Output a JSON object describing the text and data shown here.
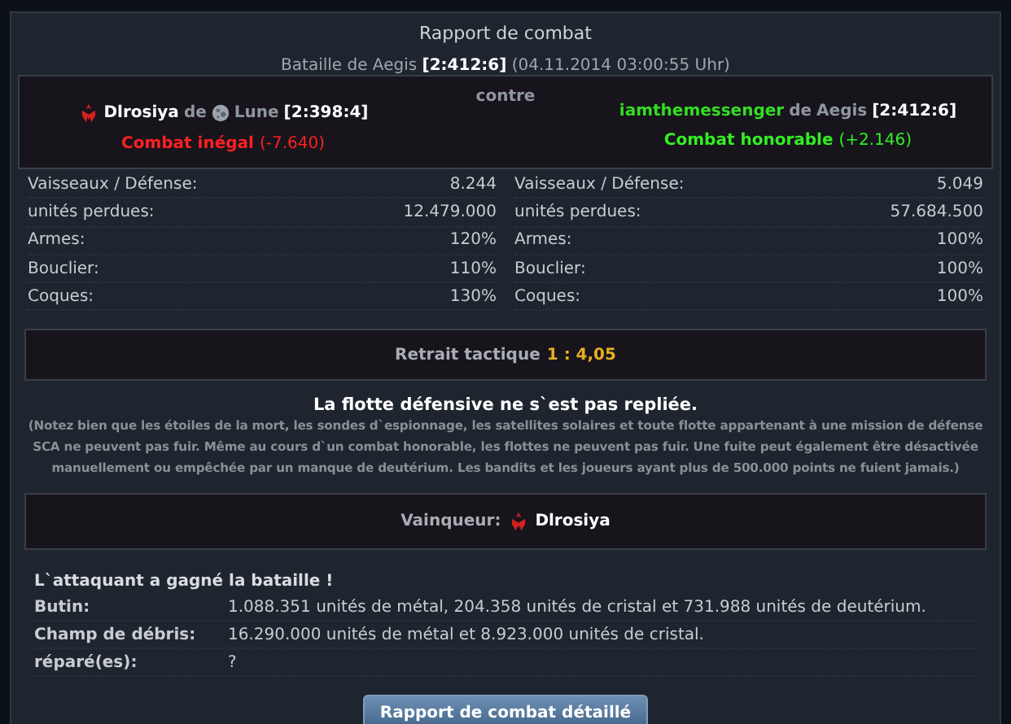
{
  "title": "Rapport de combat",
  "battle": {
    "prefix": "Bataille de Aegis",
    "coords": "[2:412:6]",
    "date": "(04.11.2014 03:00:55 Uhr)"
  },
  "versus": "contre",
  "sides": [
    {
      "name": "Dlrosiya",
      "color": "#ffffff",
      "faction_icon": true,
      "moon_icon": true,
      "of": "de",
      "place": "Lune",
      "coords": "[2:398:4]",
      "honor": {
        "kind": "unequal",
        "label": "Combat inégal",
        "value": "(-7.640)"
      },
      "stats": [
        {
          "label": "Vaisseaux / Défense:",
          "value": "8.244"
        },
        {
          "label": "unités perdues:",
          "value": "12.479.000"
        },
        {
          "label": "Armes:",
          "value": "120%"
        },
        {
          "label": "Bouclier:",
          "value": "110%"
        },
        {
          "label": "Coques:",
          "value": "130%"
        }
      ]
    },
    {
      "name": "iamthemessenger",
      "color": "#33dd22",
      "faction_icon": false,
      "moon_icon": false,
      "of": "de",
      "place": "Aegis",
      "coords": "[2:412:6]",
      "honor": {
        "kind": "honorable",
        "label": "Combat honorable",
        "value": "(+2.146)"
      },
      "stats": [
        {
          "label": "Vaisseaux / Défense:",
          "value": "5.049"
        },
        {
          "label": "unités perdues:",
          "value": "57.684.500"
        },
        {
          "label": "Armes:",
          "value": "100%"
        },
        {
          "label": "Bouclier:",
          "value": "100%"
        },
        {
          "label": "Coques:",
          "value": "100%"
        }
      ]
    }
  ],
  "retreat": {
    "label": "Retrait tactique",
    "ratio": "1 : 4,05"
  },
  "fleet_note": "La flotte défensive ne s`est pas repliée.",
  "disclaimer": "(Notez bien que les étoiles de la mort, les sondes d`espionnage, les satellites solaires et toute flotte appartenant à une mission de défense SCA ne peuvent pas fuir. Même au cours d`un combat honorable, les flottes ne peuvent pas fuir. Une fuite peut également être désactivée manuellement ou empêchée par un manque de deutérium. Les bandits et les joueurs ayant plus de 500.000 points ne fuient jamais.)",
  "winner": {
    "label": "Vainqueur:",
    "name": "Dlrosiya",
    "faction_icon": true
  },
  "result": {
    "headline": "L`attaquant a gagné la bataille !",
    "rows": [
      {
        "label": "Butin:",
        "value": "1.088.351 unités de métal, 204.358 unités de cristal et 731.988 unités de deutérium."
      },
      {
        "label": "Champ de débris:",
        "value": "16.290.000 unités de métal et 8.923.000 unités de cristal."
      },
      {
        "label": "réparé(es):",
        "value": "?"
      }
    ]
  },
  "button": "Rapport de combat détaillé"
}
